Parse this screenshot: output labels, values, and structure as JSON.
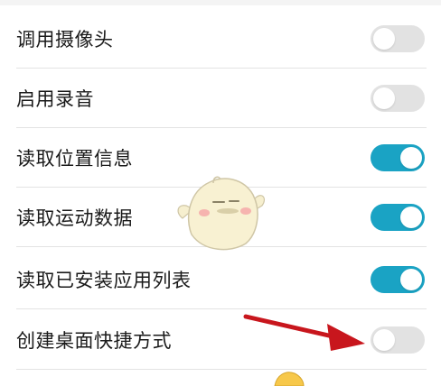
{
  "settings": {
    "items": [
      {
        "label": "调用摄像头",
        "enabled": false
      },
      {
        "label": "启用录音",
        "enabled": false
      },
      {
        "label": "读取位置信息",
        "enabled": true
      },
      {
        "label": "读取运动数据",
        "enabled": true
      },
      {
        "label": "读取已安装应用列表",
        "enabled": true
      },
      {
        "label": "创建桌面快捷方式",
        "enabled": false
      }
    ]
  },
  "colors": {
    "toggle_on": "#1aa3c4",
    "toggle_off": "#e2e2e2",
    "arrow": "#c8161d"
  }
}
